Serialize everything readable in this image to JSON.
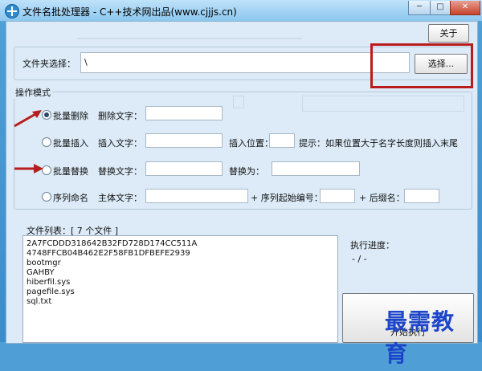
{
  "window": {
    "title": "文件名批处理器 - C++技术网出品(www.cjjjs.cn)",
    "minimize": "─",
    "maximize": "□",
    "close": "✕"
  },
  "toolbar": {
    "about": "关于"
  },
  "folder": {
    "label": "文件夹选择：",
    "path": "\\",
    "browse": "选择..."
  },
  "mode": {
    "legend": "操作模式",
    "delete": {
      "label": "批量删除",
      "text_label": "删除文字：",
      "text_value": ""
    },
    "insert": {
      "label": "批量插入",
      "text_label": "插入文字：",
      "text_value": "",
      "pos_label": "插入位置：",
      "pos_value": "",
      "hint": "提示：如果位置大于名字长度则插入末尾"
    },
    "replace": {
      "label": "批量替换",
      "text_label": "替换文字：",
      "text_value": "",
      "with_label": "替换为：",
      "with_value": ""
    },
    "sequence": {
      "label": "序列命名",
      "main_label": "主体文字：",
      "main_value": "",
      "start_label": "+ 序列起始编号：",
      "start_value": "",
      "suffix_label": "+ 后缀名：",
      "suffix_value": ""
    }
  },
  "files": {
    "label": "文件列表：[ 7 个文件 ]",
    "items": [
      "2A7FCDDD318642B32FD728D174CC511A",
      "4748FFCB04B462E2F58FB1DFBEFE2939",
      "bootmgr",
      "GAHBY",
      "hiberfil.sys",
      "pagefile.sys",
      "sql.txt"
    ]
  },
  "progress": {
    "label": "执行进度：",
    "value": "- / -"
  },
  "run": {
    "label": "开始执行"
  },
  "watermark": "最需教育",
  "colors": {
    "annotation_red": "#b91c1c",
    "watermark_blue": "#1c45c9"
  }
}
